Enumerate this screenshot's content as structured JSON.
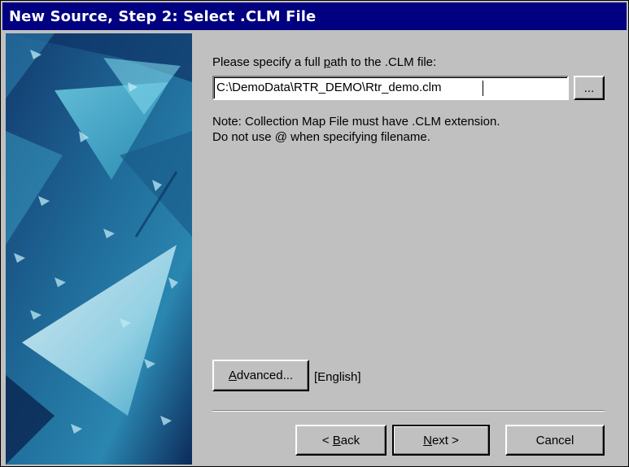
{
  "window": {
    "title": "New Source, Step 2: Select .CLM File"
  },
  "form": {
    "path_label_pre": "Please specify a full ",
    "path_label_accel": "p",
    "path_label_post": "ath to the .CLM file:",
    "path_value": "C:\\DemoData\\RTR_DEMO\\Rtr_demo.clm",
    "browse_label": "...",
    "note_line1": "Note: Collection Map File must have .CLM extension.",
    "note_line2": "Do not use @ when specifying filename."
  },
  "advanced": {
    "label_accel": "A",
    "label_rest": "dvanced...",
    "language": "[English]"
  },
  "buttons": {
    "back_pre": "< ",
    "back_accel": "B",
    "back_post": "ack",
    "next_accel": "N",
    "next_post": "ext >",
    "cancel": "Cancel"
  },
  "colors": {
    "titlebar": "#000080",
    "dialog_face": "#c0c0c0",
    "art_dark": "#0c2a5a",
    "art_teal": "#39a7c6"
  }
}
